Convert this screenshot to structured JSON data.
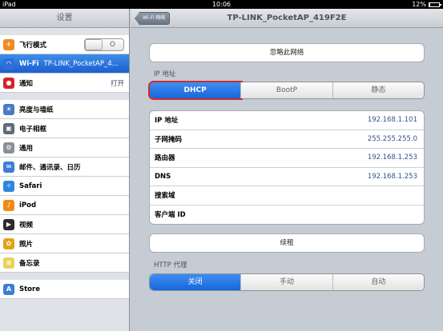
{
  "status": {
    "carrier": "iPad",
    "time": "10:06",
    "battery": "12%",
    "battery_level": 0.12
  },
  "sidebar": {
    "title": "设置",
    "items": [
      {
        "label": "飞行模式",
        "toggle": "O",
        "icon": "airplane-icon",
        "color": "#f28b1d"
      },
      {
        "label": "Wi-Fi",
        "value": "TP-LINK_PocketAP_4...",
        "icon": "wifi-icon",
        "color": "#2f6fd9"
      },
      {
        "label": "通知",
        "value": "打开",
        "icon": "notification-icon",
        "color": "#d8232a"
      },
      {
        "label": "亮度与墙纸",
        "icon": "brightness-icon",
        "color": "#4a7bc2"
      },
      {
        "label": "电子相框",
        "icon": "picture-frame-icon",
        "color": "#5e6a78"
      },
      {
        "label": "通用",
        "icon": "gear-icon",
        "color": "#8a9099"
      },
      {
        "label": "邮件、通讯录、日历",
        "icon": "mail-icon",
        "color": "#3d7dd8"
      },
      {
        "label": "Safari",
        "icon": "compass-icon",
        "color": "#2e86de"
      },
      {
        "label": "iPod",
        "icon": "ipod-icon",
        "color": "#f08a12"
      },
      {
        "label": "视频",
        "icon": "video-icon",
        "color": "#2b2b2b"
      },
      {
        "label": "照片",
        "icon": "sunflower-icon",
        "color": "#e0a418"
      },
      {
        "label": "备忘录",
        "icon": "notes-icon",
        "color": "#e9d25a"
      },
      {
        "label": "Store",
        "icon": "store-icon",
        "color": "#3b7ed6"
      }
    ]
  },
  "main": {
    "back": "Wi-Fi 网络",
    "title": "TP-LINK_PocketAP_419F2E",
    "forget": "忽略此网络",
    "ip_label": "IP 地址",
    "ip_modes": [
      "DHCP",
      "BootP",
      "静态"
    ],
    "rows": [
      {
        "k": "IP 地址",
        "v": "192.168.1.101"
      },
      {
        "k": "子网掩码",
        "v": "255.255.255.0"
      },
      {
        "k": "路由器",
        "v": "192.168.1.253"
      },
      {
        "k": "DNS",
        "v": "192.168.1.253"
      },
      {
        "k": "搜索域",
        "v": ""
      },
      {
        "k": "客户端 ID",
        "v": ""
      }
    ],
    "renew": "续租",
    "proxy_label": "HTTP 代理",
    "proxy_modes": [
      "关闭",
      "手动",
      "自动"
    ]
  }
}
